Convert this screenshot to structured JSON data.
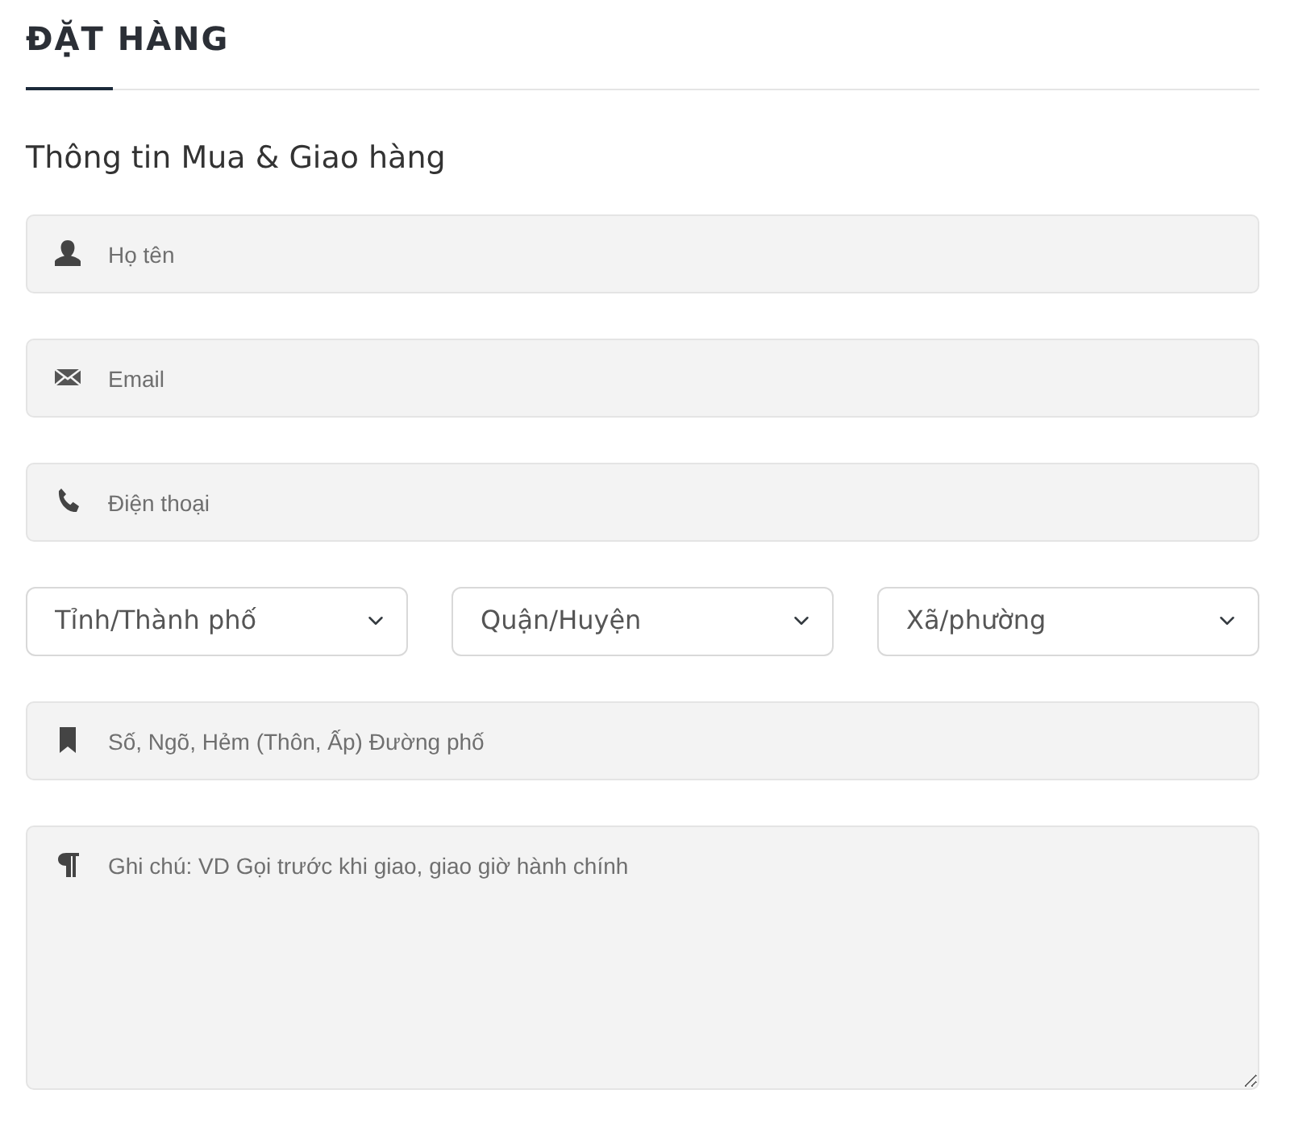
{
  "heading": "ĐẶT HÀNG",
  "subtitle": "Thông tin Mua & Giao hàng",
  "contact_fields": [
    {
      "kind": "person",
      "placeholder": "Họ tên"
    },
    {
      "kind": "mail",
      "placeholder": "Email"
    },
    {
      "kind": "phone",
      "placeholder": "Điện thoại"
    }
  ],
  "location_selects": [
    {
      "value": "Tỉnh/Thành phố"
    },
    {
      "value": "Quận/Huyện"
    },
    {
      "value": "Xã/phường"
    }
  ],
  "address_field": {
    "placeholder": "Số, Ngõ, Hẻm (Thôn, Ấp) Đường phố"
  },
  "note_field": {
    "placeholder": "Ghi chú: VD Gọi trước khi giao, giao giờ hành chính"
  }
}
